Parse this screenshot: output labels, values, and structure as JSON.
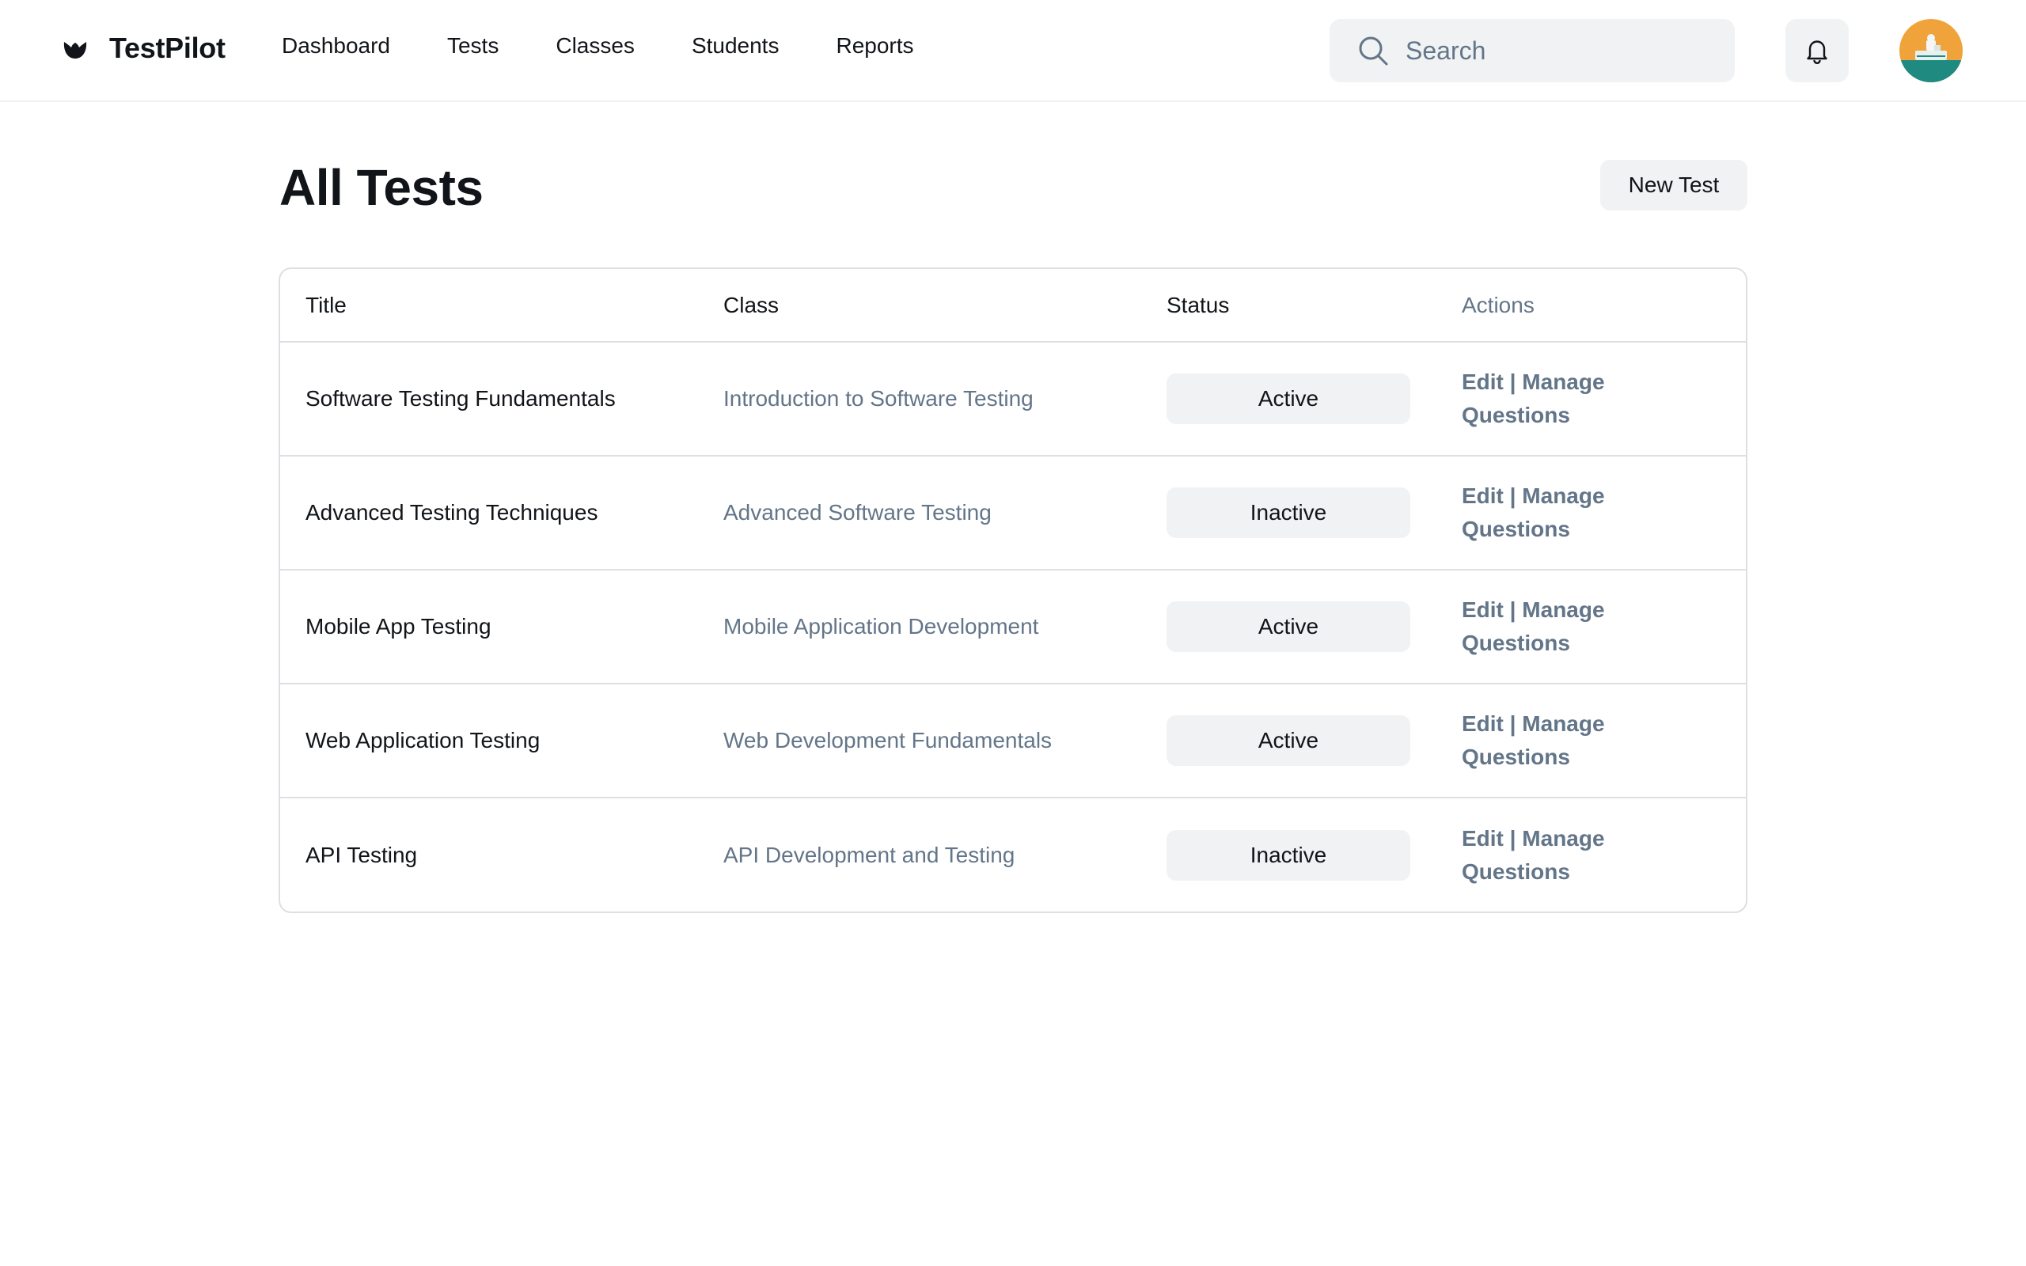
{
  "app": {
    "name": "TestPilot",
    "logo_icon": "bowl-logo-icon"
  },
  "nav": {
    "items": [
      {
        "label": "Dashboard"
      },
      {
        "label": "Tests"
      },
      {
        "label": "Classes"
      },
      {
        "label": "Students"
      },
      {
        "label": "Reports"
      }
    ]
  },
  "search": {
    "placeholder": "Search",
    "icon": "search-icon"
  },
  "notifications": {
    "icon": "bell-icon"
  },
  "user": {
    "avatar": "avatar-illustration"
  },
  "main": {
    "title": "All Tests",
    "new_test_label": "New Test"
  },
  "table": {
    "columns": [
      "Title",
      "Class",
      "Status",
      "Actions"
    ],
    "rows": [
      {
        "title": "Software Testing Fundamentals",
        "class": "Introduction to Software Testing",
        "status": "Active",
        "edit": "Edit",
        "separator": "|",
        "manage": "Manage Questions"
      },
      {
        "title": "Advanced Testing Techniques",
        "class": "Advanced Software Testing",
        "status": "Inactive",
        "edit": "Edit",
        "separator": "|",
        "manage": "Manage Questions"
      },
      {
        "title": "Mobile App Testing",
        "class": "Mobile Application Development",
        "status": "Active",
        "edit": "Edit",
        "separator": "|",
        "manage": "Manage Questions"
      },
      {
        "title": "Web Application Testing",
        "class": "Web Development Fundamentals",
        "status": "Active",
        "edit": "Edit",
        "separator": "|",
        "manage": "Manage Questions"
      },
      {
        "title": "API Testing",
        "class": "API Development and Testing",
        "status": "Inactive",
        "edit": "Edit",
        "separator": "|",
        "manage": "Manage Questions"
      }
    ]
  },
  "colors": {
    "text": "#111418",
    "muted": "#637588",
    "surface": "#f0f2f4",
    "border": "#dce0e5",
    "avatar_orange": "#f0a33a",
    "avatar_teal": "#1f8a80"
  }
}
